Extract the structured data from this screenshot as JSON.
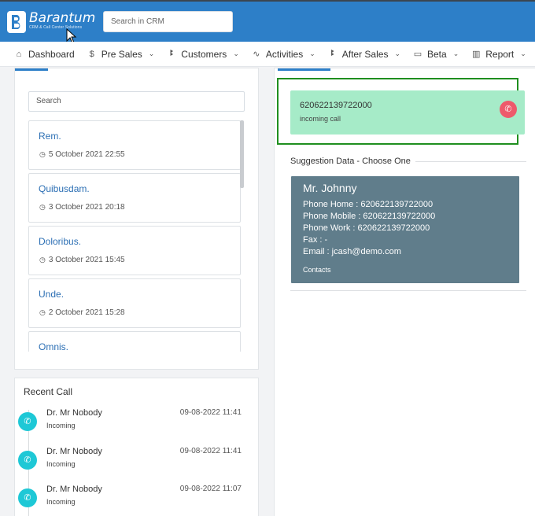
{
  "header": {
    "logo_name": "Barantum",
    "logo_tagline": "CRM & Call Center Solutions",
    "search_placeholder": "Search in CRM"
  },
  "nav": [
    {
      "label": "Dashboard",
      "icon": "home-icon"
    },
    {
      "label": "Pre Sales",
      "icon": "dollar-icon"
    },
    {
      "label": "Customers",
      "icon": "users-icon"
    },
    {
      "label": "Activities",
      "icon": "pulse-icon"
    },
    {
      "label": "After Sales",
      "icon": "users-icon"
    },
    {
      "label": "Beta",
      "icon": "folder-icon"
    },
    {
      "label": "Report",
      "icon": "bar-chart-icon"
    }
  ],
  "notes": {
    "search_placeholder": "Search",
    "items": [
      {
        "title": "Rem.",
        "date": "5 October 2021 22:55"
      },
      {
        "title": "Quibusdam.",
        "date": "3 October 2021 20:18"
      },
      {
        "title": "Doloribus.",
        "date": "3 October 2021 15:45"
      },
      {
        "title": "Unde.",
        "date": "2 October 2021 15:28"
      },
      {
        "title": "Omnis.",
        "date": ""
      }
    ]
  },
  "recent_call": {
    "title": "Recent Call",
    "items": [
      {
        "name": "Dr. Mr Nobody",
        "type": "Incoming",
        "time": "09-08-2022 11:41"
      },
      {
        "name": "Dr. Mr Nobody",
        "type": "Incoming",
        "time": "09-08-2022 11:41"
      },
      {
        "name": "Dr. Mr Nobody",
        "type": "Incoming",
        "time": "09-08-2022 11:07"
      }
    ]
  },
  "incoming": {
    "number": "620622139722000",
    "status": "incoming call"
  },
  "suggestion": {
    "title": "Suggestion Data - Choose One",
    "contact": {
      "name": "Mr. Johnny",
      "phone_home": "Phone Home : 620622139722000",
      "phone_mobile": "Phone Mobile : 620622139722000",
      "phone_work": "Phone Work : 620622139722000",
      "fax": "Fax : -",
      "email": "Email : jcash@demo.com",
      "link": "Contacts"
    }
  },
  "colors": {
    "header": "#2d7fc8",
    "incoming_card": "#a6ebc8",
    "contact_card": "#607d8b",
    "hangup": "#ee5a6b",
    "call_icon": "#1ec8d6",
    "highlight": "#1f8f1f"
  }
}
